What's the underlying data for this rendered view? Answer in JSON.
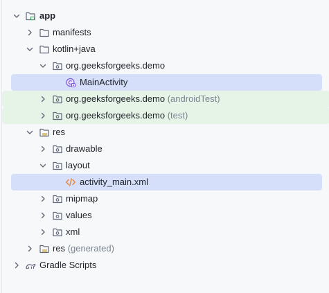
{
  "tree": {
    "items": [
      {
        "name": "app",
        "meta": ""
      },
      {
        "name": "manifests",
        "meta": ""
      },
      {
        "name": "kotlin+java",
        "meta": ""
      },
      {
        "name": "org.geeksforgeeks.demo",
        "meta": ""
      },
      {
        "name": "MainActivity",
        "meta": ""
      },
      {
        "name": "org.geeksforgeeks.demo",
        "meta": "(androidTest)"
      },
      {
        "name": "org.geeksforgeeks.demo",
        "meta": "(test)"
      },
      {
        "name": "res",
        "meta": ""
      },
      {
        "name": "drawable",
        "meta": ""
      },
      {
        "name": "layout",
        "meta": ""
      },
      {
        "name": "activity_main.xml",
        "meta": ""
      },
      {
        "name": "mipmap",
        "meta": ""
      },
      {
        "name": "values",
        "meta": ""
      },
      {
        "name": "xml",
        "meta": ""
      },
      {
        "name": "res",
        "meta": "(generated)"
      },
      {
        "name": "Gradle Scripts",
        "meta": ""
      }
    ]
  },
  "icons": [
    "chevron-down-icon",
    "chevron-right-icon",
    "module-folder-icon",
    "folder-icon",
    "package-folder-icon",
    "resource-folder-icon",
    "kotlin-activity-icon",
    "xml-file-icon",
    "gradle-elephant-icon"
  ],
  "colors": {
    "selected_row": "#d5dff9",
    "test_row": "#e6f4e8",
    "meta_text": "#7b8393",
    "folder_icon": "#5f6778",
    "activity_icon": "#7a5ad7",
    "xml_icon": "#e8823a",
    "resource_bar": "#d0a63a"
  }
}
